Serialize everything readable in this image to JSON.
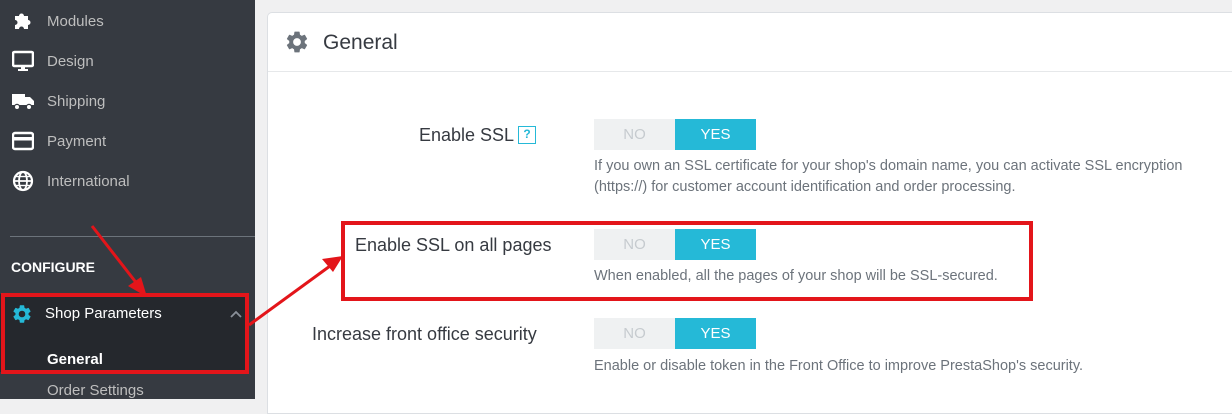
{
  "sidebar": {
    "items": [
      {
        "label": "Modules",
        "icon": "puzzle-icon"
      },
      {
        "label": "Design",
        "icon": "monitor-icon"
      },
      {
        "label": "Shipping",
        "icon": "truck-icon"
      },
      {
        "label": "Payment",
        "icon": "credit-card-icon"
      },
      {
        "label": "International",
        "icon": "globe-icon"
      }
    ],
    "section_title": "CONFIGURE",
    "active_group": {
      "label": "Shop Parameters",
      "icon": "gear-icon",
      "sub_items": [
        {
          "label": "General",
          "active": true
        },
        {
          "label": "Order Settings",
          "active": false
        }
      ]
    }
  },
  "panel": {
    "title": "General",
    "icon": "gear-icon",
    "help_badge": "?",
    "settings": [
      {
        "label": "Enable SSL",
        "no_label": "NO",
        "yes_label": "YES",
        "value": "YES",
        "help_line1": "If you own an SSL certificate for your shop's domain name, you can activate SSL encryption",
        "help_line2": "(https://) for customer account identification and order processing."
      },
      {
        "label": "Enable SSL on all pages",
        "no_label": "NO",
        "yes_label": "YES",
        "value": "YES",
        "help_line1": "When enabled, all the pages of your shop will be SSL-secured."
      },
      {
        "label": "Increase front office security",
        "no_label": "NO",
        "yes_label": "YES",
        "value": "YES",
        "help_line1": "Enable or disable token in the Front Office to improve PrestaShop's security."
      }
    ]
  },
  "colors": {
    "sidebar_bg": "#363a41",
    "active_group_bg": "#25282d",
    "accent": "#25b9d7",
    "annotation_red": "#e3151a"
  }
}
